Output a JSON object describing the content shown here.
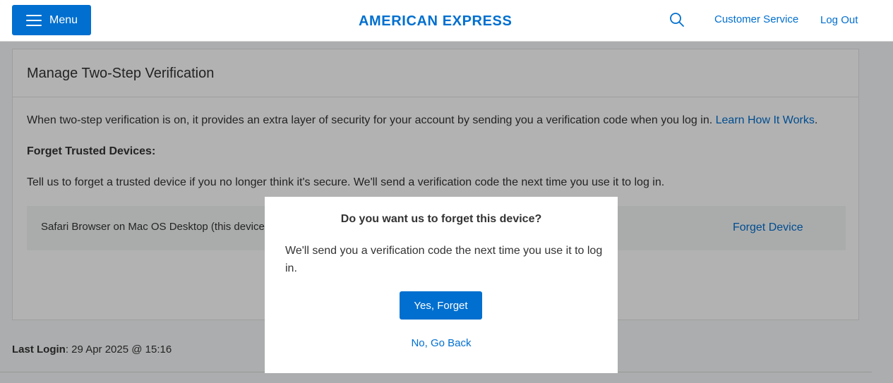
{
  "header": {
    "menu_label": "Menu",
    "logo_text": "AMERICAN EXPRESS",
    "search_icon": "search-icon",
    "customer_service": "Customer Service",
    "log_out": "Log Out"
  },
  "card": {
    "title": "Manage Two-Step Verification",
    "intro_text": "When two-step verification is on, it provides an extra layer of security for your account by sending you a verification code when you log in.",
    "learn_link": "Learn How It Works",
    "intro_end": ".",
    "subheading": "Forget Trusted Devices:",
    "tell_text": "Tell us to forget a trusted device if you no longer think it's secure. We'll send a verification code the next time you use it to log in.",
    "device": {
      "name": "Safari Browser on Mac OS Desktop (this device)",
      "action": "Forget Device"
    }
  },
  "footer": {
    "last_login_label": "Last Login",
    "last_login_value": ": 29 Apr 2025 @ 15:16"
  },
  "modal": {
    "title": "Do you want us to forget this device?",
    "body": "We'll send you a verification code the next time you use it to log in.",
    "confirm_label": "Yes, Forget",
    "cancel_label": "No, Go Back"
  },
  "colors": {
    "brand_blue": "#006fcf",
    "overlay": "rgba(0,0,0,0.30)"
  }
}
